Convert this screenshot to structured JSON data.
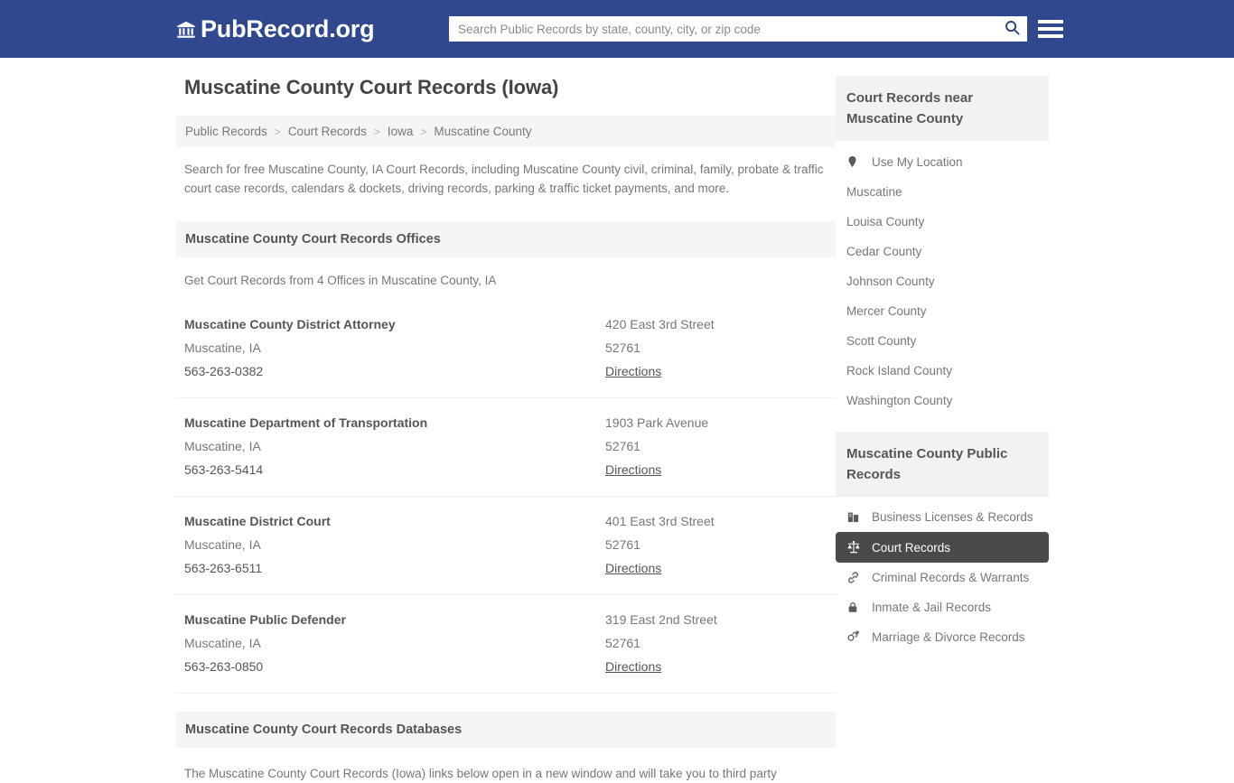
{
  "header": {
    "brand_icon": "bank-building-icon",
    "brand_name": "PubRecord.org",
    "search_placeholder": "Search Public Records by state, county, city, or zip code",
    "search_value": "",
    "search_icon": "search-icon",
    "menu_icon": "hamburger-menu-icon",
    "bg_color": "#30488d"
  },
  "main": {
    "title": "Muscatine County Court Records (Iowa)",
    "breadcrumb": {
      "separator": ">",
      "items": [
        {
          "label": "Public Records"
        },
        {
          "label": "Court Records"
        },
        {
          "label": "Iowa"
        },
        {
          "label": "Muscatine County"
        }
      ]
    },
    "intro": "Search for free Muscatine County, IA Court Records, including Muscatine County civil, criminal, family, probate & traffic court case records, calendars & dockets, driving records, parking & traffic ticket payments, and more.",
    "offices_section": {
      "heading": "Muscatine County Court Records Offices",
      "note": "Get Court Records from 4 Offices in Muscatine County, IA",
      "directions_label": "Directions",
      "rows": [
        {
          "name": "Muscatine County District Attorney",
          "city": "Muscatine, IA",
          "phone": "563-263-0382",
          "street": "420 East 3rd Street",
          "zip": "52761",
          "directions": "Directions"
        },
        {
          "name": "Muscatine Department of Transportation",
          "city": "Muscatine, IA",
          "phone": "563-263-5414",
          "street": "1903 Park Avenue",
          "zip": "52761",
          "directions": "Directions"
        },
        {
          "name": "Muscatine District Court",
          "city": "Muscatine, IA",
          "phone": "563-263-6511",
          "street": "401 East 3rd Street",
          "zip": "52761",
          "directions": "Directions"
        },
        {
          "name": "Muscatine Public Defender",
          "city": "Muscatine, IA",
          "phone": "563-263-0850",
          "street": "319 East 2nd Street",
          "zip": "52761",
          "directions": "Directions"
        }
      ]
    },
    "databases_section": {
      "heading": "Muscatine County Court Records Databases",
      "note": "The Muscatine County Court Records (Iowa) links below open in a new window and will take you to third party"
    }
  },
  "sidebar": {
    "near_panel": {
      "heading": "Court Records near Muscatine County",
      "items": [
        {
          "label": "Use My Location",
          "icon": "map-pin-icon"
        },
        {
          "label": "Muscatine",
          "icon": ""
        },
        {
          "label": "Louisa County",
          "icon": ""
        },
        {
          "label": "Cedar County",
          "icon": ""
        },
        {
          "label": "Johnson County",
          "icon": ""
        },
        {
          "label": "Mercer County",
          "icon": ""
        },
        {
          "label": "Scott County",
          "icon": ""
        },
        {
          "label": "Rock Island County",
          "icon": ""
        },
        {
          "label": "Washington County",
          "icon": ""
        }
      ]
    },
    "records_panel": {
      "heading": "Muscatine County Public Records",
      "active_item": "Court Records",
      "active_bg": "#4a4a4a",
      "items": [
        {
          "label": "Business Licenses & Records",
          "icon": "briefcase-icon",
          "active": false
        },
        {
          "label": "Court Records",
          "icon": "scales-of-justice-icon",
          "active": true
        },
        {
          "label": "Criminal Records & Warrants",
          "icon": "link-chain-icon",
          "active": false
        },
        {
          "label": "Inmate & Jail Records",
          "icon": "padlock-icon",
          "active": false
        },
        {
          "label": "Marriage & Divorce Records",
          "icon": "male-female-icon",
          "active": false
        }
      ]
    }
  }
}
